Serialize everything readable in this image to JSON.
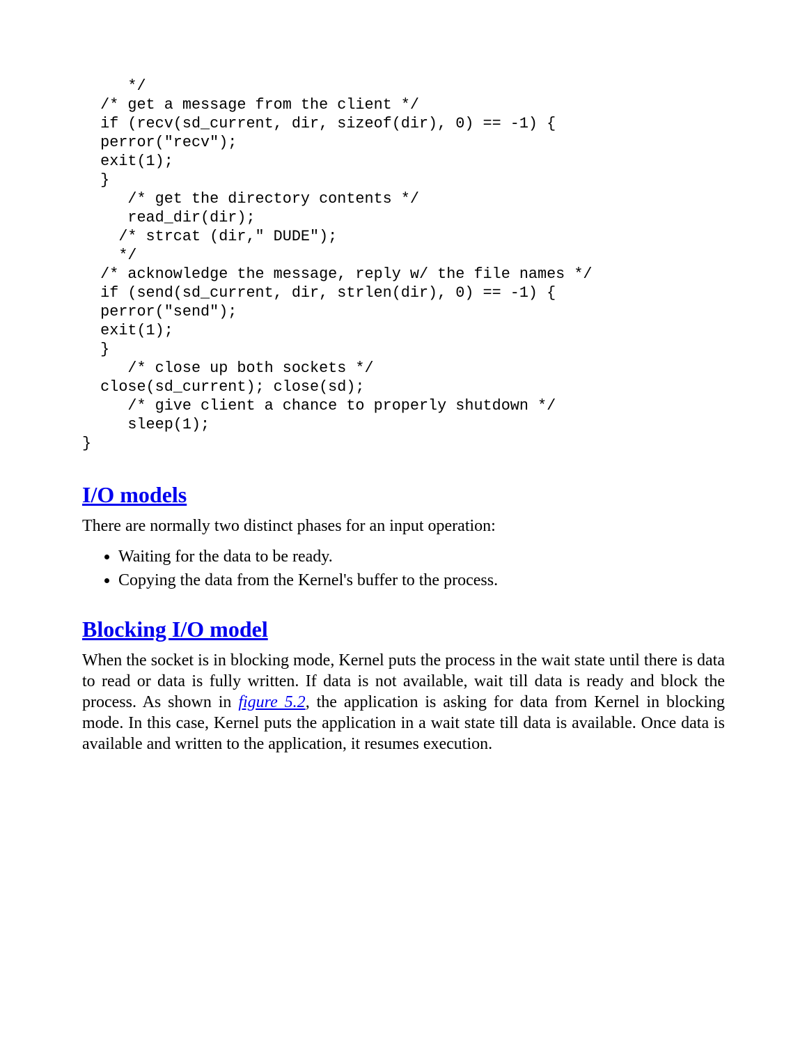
{
  "code": "     */\n  /* get a message from the client */\n  if (recv(sd_current, dir, sizeof(dir), 0) == -1) {\n  perror(\"recv\");\n  exit(1);\n  }\n     /* get the directory contents */\n     read_dir(dir);\n    /* strcat (dir,\" DUDE\");\n    */\n  /* acknowledge the message, reply w/ the file names */\n  if (send(sd_current, dir, strlen(dir), 0) == -1) {\n  perror(\"send\");\n  exit(1);\n  }\n     /* close up both sockets */\n  close(sd_current); close(sd);\n     /* give client a chance to properly shutdown */\n     sleep(1);\n}",
  "sections": {
    "io_models": {
      "title": "I/O models",
      "intro": "There are normally two distinct phases for an input operation:",
      "bullets": [
        "Waiting for the data to be ready.",
        "Copying the data from the Kernel's buffer to the process."
      ]
    },
    "blocking": {
      "title": "Blocking I/O model",
      "para_before_ref": "When the socket is in blocking mode, Kernel puts the process in the wait state until there is data to read or data is fully written. If data is not available, wait till data is ready and block the process. As shown in ",
      "ref_text": "figure 5.2",
      "para_after_ref": ", the application is asking for data from Kernel in blocking mode. In this case, Kernel puts the application in a wait state till data is available. Once data is available and written to the application, it resumes execution."
    }
  }
}
